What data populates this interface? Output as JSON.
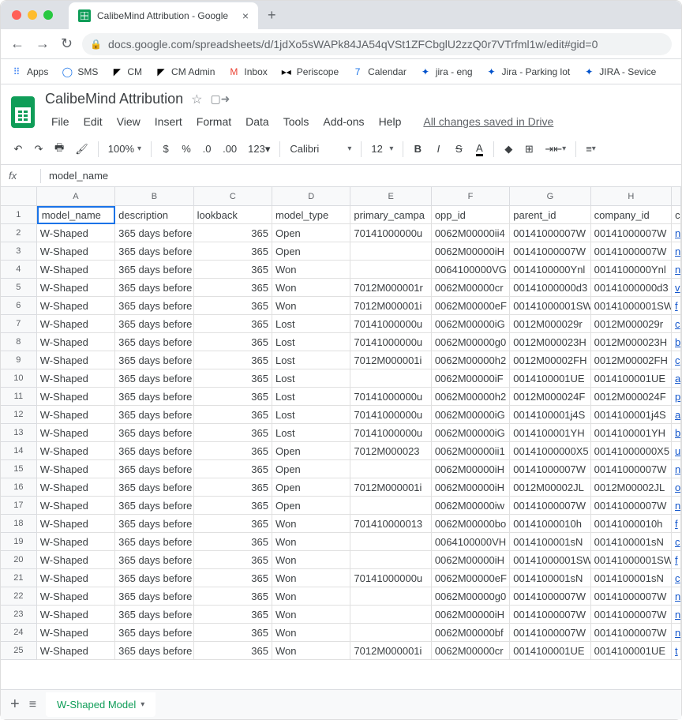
{
  "browser": {
    "tab_title": "CalibeMind Attribution - Google",
    "url_display": "docs.google.com/spreadsheets/d/1jdXo5sWAPk84JA54qVSt1ZFCbglU2zzQ0r7VTrfml1w/edit#gid=0"
  },
  "bookmarks": [
    {
      "icon": "⠿",
      "label": "Apps",
      "color": "#4285f4"
    },
    {
      "icon": "◯",
      "label": "SMS",
      "color": "#1a73e8"
    },
    {
      "icon": "◤",
      "label": "CM",
      "color": "#000"
    },
    {
      "icon": "◤",
      "label": "CM Admin",
      "color": "#000"
    },
    {
      "icon": "M",
      "label": "Inbox",
      "color": "#ea4335"
    },
    {
      "icon": "▸◂",
      "label": "Periscope",
      "color": "#000"
    },
    {
      "icon": "7",
      "label": "Calendar",
      "color": "#1a73e8"
    },
    {
      "icon": "✦",
      "label": "jira - eng",
      "color": "#0052cc"
    },
    {
      "icon": "✦",
      "label": "Jira - Parking lot",
      "color": "#0052cc"
    },
    {
      "icon": "✦",
      "label": "JIRA - Sevice",
      "color": "#0052cc"
    }
  ],
  "doc": {
    "title": "CalibeMind Attribution",
    "save_status": "All changes saved in Drive"
  },
  "menus": [
    "File",
    "Edit",
    "View",
    "Insert",
    "Format",
    "Data",
    "Tools",
    "Add-ons",
    "Help"
  ],
  "toolbar": {
    "zoom": "100%",
    "font": "Calibri",
    "size": "12"
  },
  "formula": {
    "value": "model_name"
  },
  "columns": [
    "A",
    "B",
    "C",
    "D",
    "E",
    "F",
    "G",
    "H"
  ],
  "headers": [
    "model_name",
    "description",
    "lookback",
    "model_type",
    "primary_campa",
    "opp_id",
    "parent_id",
    "company_id"
  ],
  "rows": [
    {
      "n": 1,
      "c": [
        "model_name",
        "description",
        "lookback",
        "model_type",
        "primary_campa",
        "opp_id",
        "parent_id",
        "company_id",
        "c"
      ]
    },
    {
      "n": 2,
      "c": [
        "W-Shaped",
        "365 days before",
        "365",
        "Open",
        "70141000000u",
        "0062M00000ii4",
        "00141000007W",
        "00141000007W",
        "n"
      ]
    },
    {
      "n": 3,
      "c": [
        "W-Shaped",
        "365 days before",
        "365",
        "Open",
        "",
        "0062M00000iH",
        "00141000007W",
        "00141000007W",
        "n"
      ]
    },
    {
      "n": 4,
      "c": [
        "W-Shaped",
        "365 days before",
        "365",
        "Won",
        "",
        "0064100000VG",
        "0014100000Ynl",
        "0014100000Ynl",
        "n"
      ]
    },
    {
      "n": 5,
      "c": [
        "W-Shaped",
        "365 days before",
        "365",
        "Won",
        "7012M000001r",
        "0062M00000cr",
        "00141000000d3",
        "00141000000d3",
        "v"
      ]
    },
    {
      "n": 6,
      "c": [
        "W-Shaped",
        "365 days before",
        "365",
        "Won",
        "7012M000001i",
        "0062M00000eF",
        "00141000001SW",
        "00141000001SW",
        "f"
      ]
    },
    {
      "n": 7,
      "c": [
        "W-Shaped",
        "365 days before",
        "365",
        "Lost",
        "70141000000u",
        "0062M00000iG",
        "0012M000029r",
        "0012M000029r",
        "c"
      ]
    },
    {
      "n": 8,
      "c": [
        "W-Shaped",
        "365 days before",
        "365",
        "Lost",
        "70141000000u",
        "0062M00000g0",
        "0012M000023H",
        "0012M000023H",
        "b"
      ]
    },
    {
      "n": 9,
      "c": [
        "W-Shaped",
        "365 days before",
        "365",
        "Lost",
        "7012M000001i",
        "0062M00000h2",
        "0012M00002FH",
        "0012M00002FH",
        "c"
      ]
    },
    {
      "n": 10,
      "c": [
        "W-Shaped",
        "365 days before",
        "365",
        "Lost",
        "",
        "0062M00000iF",
        "0014100001UE",
        "0014100001UE",
        "a"
      ]
    },
    {
      "n": 11,
      "c": [
        "W-Shaped",
        "365 days before",
        "365",
        "Lost",
        "70141000000u",
        "0062M00000h2",
        "0012M000024F",
        "0012M000024F",
        "p"
      ]
    },
    {
      "n": 12,
      "c": [
        "W-Shaped",
        "365 days before",
        "365",
        "Lost",
        "70141000000u",
        "0062M00000iG",
        "0014100001j4S",
        "0014100001j4S",
        "a"
      ]
    },
    {
      "n": 13,
      "c": [
        "W-Shaped",
        "365 days before",
        "365",
        "Lost",
        "70141000000u",
        "0062M00000iG",
        "0014100001YH",
        "0014100001YH",
        "b"
      ]
    },
    {
      "n": 14,
      "c": [
        "W-Shaped",
        "365 days before",
        "365",
        "Open",
        "7012M000023",
        "0062M00000ii1",
        "00141000000X5",
        "00141000000X5",
        "u"
      ]
    },
    {
      "n": 15,
      "c": [
        "W-Shaped",
        "365 days before",
        "365",
        "Open",
        "",
        "0062M00000iH",
        "00141000007W",
        "00141000007W",
        "n"
      ]
    },
    {
      "n": 16,
      "c": [
        "W-Shaped",
        "365 days before",
        "365",
        "Open",
        "7012M000001i",
        "0062M00000iH",
        "0012M00002JL",
        "0012M00002JL",
        "o"
      ]
    },
    {
      "n": 17,
      "c": [
        "W-Shaped",
        "365 days before",
        "365",
        "Open",
        "",
        "0062M00000iw",
        "00141000007W",
        "00141000007W",
        "n"
      ]
    },
    {
      "n": 18,
      "c": [
        "W-Shaped",
        "365 days before",
        "365",
        "Won",
        "701410000013",
        "0062M00000bo",
        "00141000010h",
        "00141000010h",
        "f"
      ]
    },
    {
      "n": 19,
      "c": [
        "W-Shaped",
        "365 days before",
        "365",
        "Won",
        "",
        "0064100000VH",
        "0014100001sN",
        "0014100001sN",
        "c"
      ]
    },
    {
      "n": 20,
      "c": [
        "W-Shaped",
        "365 days before",
        "365",
        "Won",
        "",
        "0062M00000iH",
        "00141000001SW",
        "00141000001SW",
        "f"
      ]
    },
    {
      "n": 21,
      "c": [
        "W-Shaped",
        "365 days before",
        "365",
        "Won",
        "70141000000u",
        "0062M00000eF",
        "0014100001sN",
        "0014100001sN",
        "c"
      ]
    },
    {
      "n": 22,
      "c": [
        "W-Shaped",
        "365 days before",
        "365",
        "Won",
        "",
        "0062M00000g0",
        "00141000007W",
        "00141000007W",
        "n"
      ]
    },
    {
      "n": 23,
      "c": [
        "W-Shaped",
        "365 days before",
        "365",
        "Won",
        "",
        "0062M00000iH",
        "00141000007W",
        "00141000007W",
        "n"
      ]
    },
    {
      "n": 24,
      "c": [
        "W-Shaped",
        "365 days before",
        "365",
        "Won",
        "",
        "0062M00000bf",
        "00141000007W",
        "00141000007W",
        "n"
      ]
    },
    {
      "n": 25,
      "c": [
        "W-Shaped",
        "365 days before",
        "365",
        "Won",
        "7012M000001i",
        "0062M00000cr",
        "0014100001UE",
        "0014100001UE",
        "t"
      ]
    }
  ],
  "sheet_tab": {
    "name": "W-Shaped Model"
  }
}
